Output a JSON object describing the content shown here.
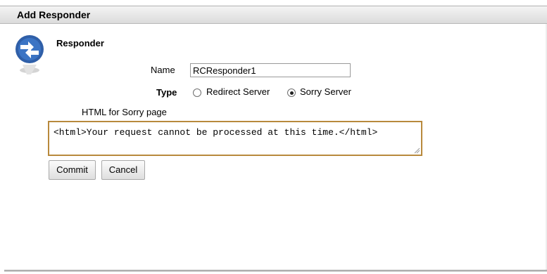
{
  "dialog": {
    "title": "Add Responder"
  },
  "section": {
    "title": "Responder"
  },
  "form": {
    "name_label": "Name",
    "name_value": "RCResponder1",
    "type_label": "Type",
    "type_options": [
      {
        "label": "Redirect Server",
        "checked": false
      },
      {
        "label": "Sorry Server",
        "checked": true
      }
    ],
    "html_label": "HTML for Sorry page",
    "html_value": "<html>Your request cannot be processed at this time.</html>"
  },
  "buttons": {
    "commit": "Commit",
    "cancel": "Cancel"
  },
  "icons": {
    "logo": "responder-logo-icon",
    "resize": "resize-grip-icon"
  },
  "colors": {
    "textarea_border": "#b8893c",
    "logo_blue": "#2f5fa8"
  }
}
